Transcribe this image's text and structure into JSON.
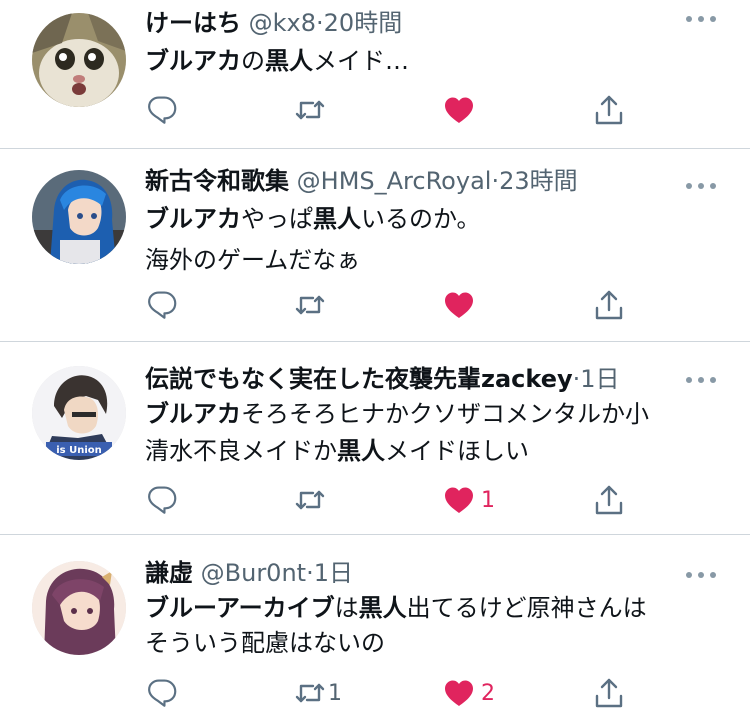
{
  "tweets": [
    {
      "name": "けーはち",
      "handle": "@kx8",
      "time": "20時間",
      "lines": [
        [
          {
            "text": "ブルアカ",
            "bold": true
          },
          {
            "text": "の",
            "bold": false
          },
          {
            "text": "黒人",
            "bold": true
          },
          {
            "text": "メイド…",
            "bold": false
          }
        ]
      ],
      "reply_count": "",
      "retweet_count": "",
      "like_count": "",
      "liked": true
    },
    {
      "name": "新古令和歌集",
      "handle": "@HMS_ArcRoyal",
      "time": "23時間",
      "lines": [
        [
          {
            "text": "ブルアカ",
            "bold": true
          },
          {
            "text": "やっぱ",
            "bold": false
          },
          {
            "text": "黒人",
            "bold": true
          },
          {
            "text": "いるのか。",
            "bold": false
          }
        ],
        [
          {
            "text": "海外のゲームだなぁ",
            "bold": false
          }
        ]
      ],
      "reply_count": "",
      "retweet_count": "",
      "like_count": "",
      "liked": true
    },
    {
      "name": "伝説でもなく実在した夜襲先輩zackey",
      "handle": "",
      "time": "1日",
      "lines": [
        [
          {
            "text": "ブルアカ",
            "bold": true
          },
          {
            "text": "そろそろヒナかクソザコメンタルか小",
            "bold": false
          }
        ],
        [
          {
            "text": "清水不良メイドか",
            "bold": false
          },
          {
            "text": "黒人",
            "bold": true
          },
          {
            "text": "メイドほしい",
            "bold": false
          }
        ]
      ],
      "reply_count": "",
      "retweet_count": "",
      "like_count": "1",
      "liked": true
    },
    {
      "name": "謙虚",
      "handle": "@Bur0nt",
      "time": "1日",
      "lines": [
        [
          {
            "text": "ブルーアーカイブ",
            "bold": true
          },
          {
            "text": "は",
            "bold": false
          },
          {
            "text": "黒人",
            "bold": true
          },
          {
            "text": "出てるけど原神さんは",
            "bold": false
          }
        ],
        [
          {
            "text": "そういう配慮はないの",
            "bold": false
          }
        ]
      ],
      "reply_count": "",
      "retweet_count": "1",
      "like_count": "2",
      "liked": true
    }
  ],
  "avatar_text": "is Union",
  "icons": {
    "reply": "reply-icon",
    "retweet": "retweet-icon",
    "like": "heart-icon",
    "share": "share-icon",
    "more": "more-icon"
  },
  "colors": {
    "like": "#e0245e",
    "secondary": "#536471",
    "icon": "#5b7083",
    "divider": "#cfd6dc"
  }
}
